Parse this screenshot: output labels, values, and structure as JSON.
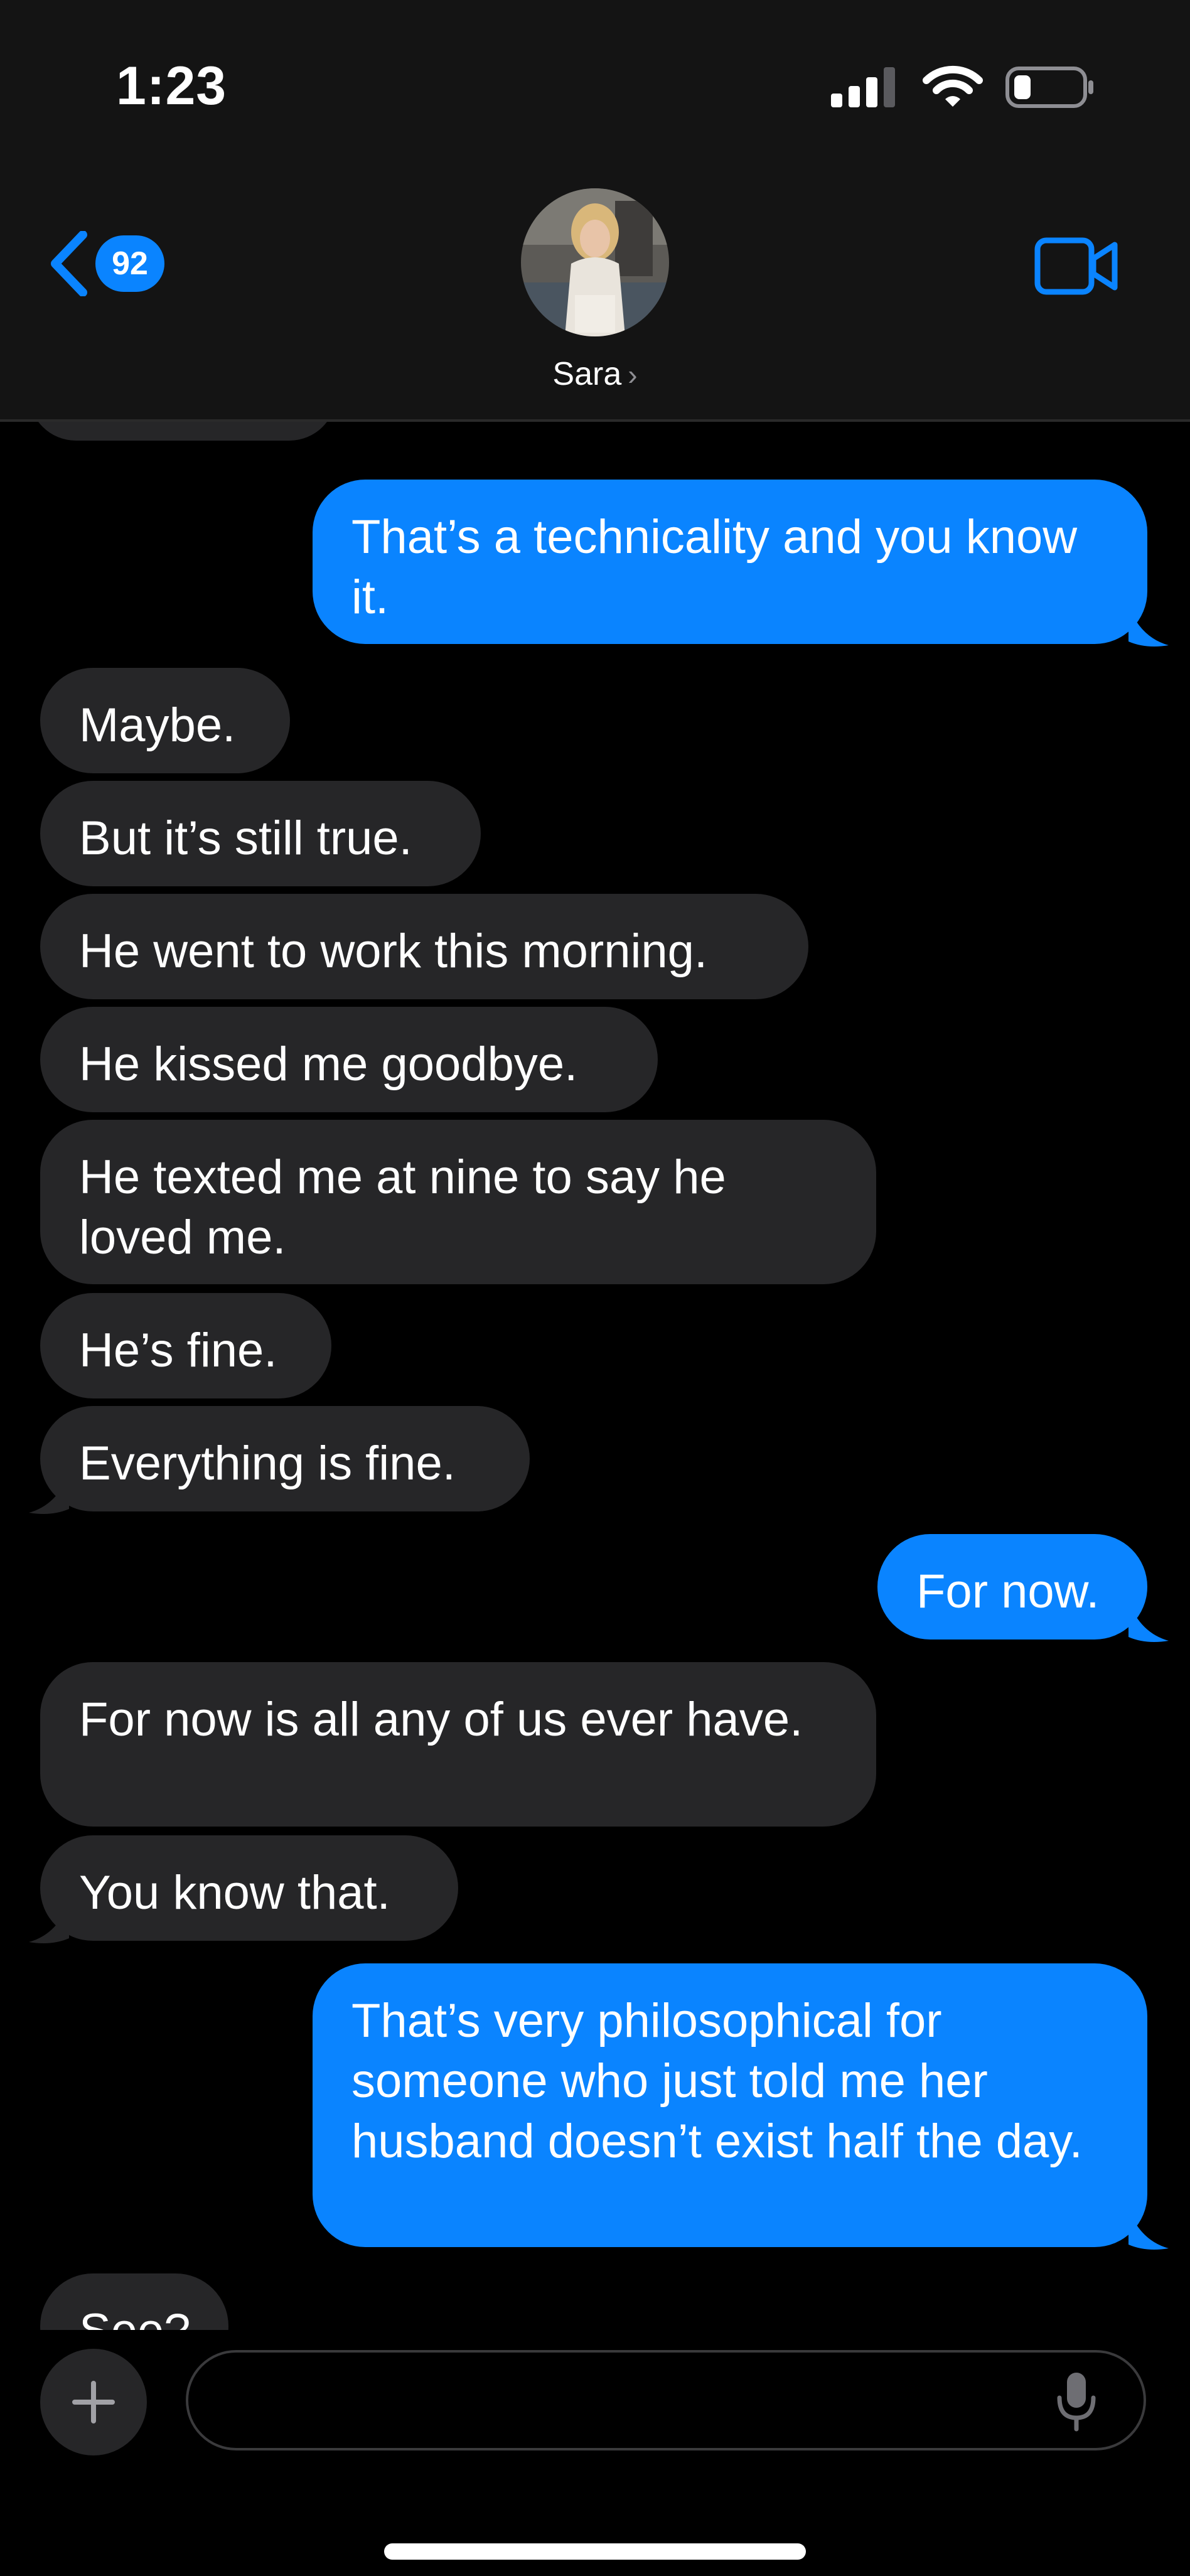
{
  "status_bar": {
    "time": "1:23",
    "icons": [
      "cellular-signal-icon",
      "wifi-icon",
      "battery-icon"
    ]
  },
  "header": {
    "back_count": "92",
    "contact_name": "Sara",
    "accent_color": "#0a84ff"
  },
  "messages": [
    {
      "from": "them",
      "text": "..."
    },
    {
      "from": "me",
      "text": "That’s a technicality and you know it."
    },
    {
      "from": "them",
      "text": "Maybe."
    },
    {
      "from": "them",
      "text": "But it’s still true."
    },
    {
      "from": "them",
      "text": "He went to work this morning."
    },
    {
      "from": "them",
      "text": "He kissed me goodbye."
    },
    {
      "from": "them",
      "text": "He texted me at nine to say he loved me."
    },
    {
      "from": "them",
      "text": "He’s fine."
    },
    {
      "from": "them",
      "text": "Everything is fine."
    },
    {
      "from": "me",
      "text": "For now."
    },
    {
      "from": "them",
      "text": "For now is all any of us ever have."
    },
    {
      "from": "them",
      "text": "You know that."
    },
    {
      "from": "me",
      "text": "That’s very philosophical for someone who just told me her husband doesn’t exist half the day."
    },
    {
      "from": "them",
      "text": "See?"
    }
  ],
  "composer": {
    "placeholder": "",
    "icons": [
      "plus-icon",
      "microphone-icon"
    ]
  },
  "colors": {
    "incoming_bubble": "#262628",
    "outgoing_bubble": "#0a84ff",
    "header_bg": "#141414"
  }
}
